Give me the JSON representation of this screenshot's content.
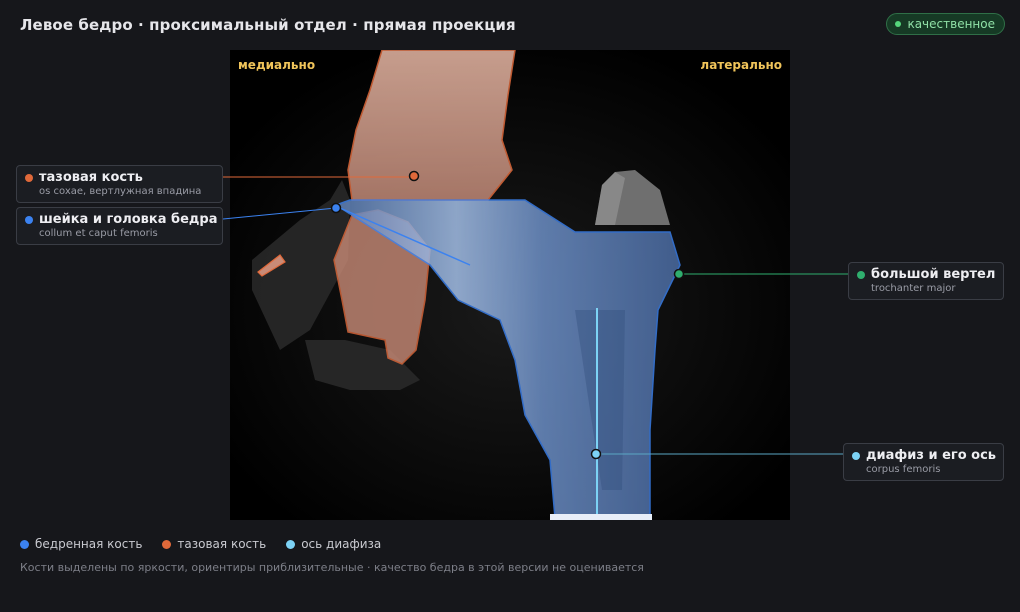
{
  "header": {
    "title": "Левое бедро · проксимальный отдел · прямая проекция",
    "quality_badge": "качественное",
    "quality_color": "#55d67c"
  },
  "viewer": {
    "orientation_left": "медиально",
    "orientation_right": "латерально"
  },
  "callouts": {
    "pelvis": {
      "name": "тазовая кость",
      "latin": "os coxae, вертлужная впадина",
      "color": "#e0693a"
    },
    "neck": {
      "name": "шейка и головка бедра",
      "latin": "collum et caput femoris",
      "color": "#3b82f0"
    },
    "trochanter": {
      "name": "большой вертел",
      "latin": "trochanter major",
      "color": "#2fae6e"
    },
    "shaft": {
      "name": "диафиз и его ось",
      "latin": "corpus femoris",
      "color": "#7cd2f5"
    }
  },
  "legend": {
    "femur": {
      "label": "бедренная кость",
      "color": "#3b82f0"
    },
    "pelvis": {
      "label": "тазовая кость",
      "color": "#e0693a"
    },
    "axis": {
      "label": "ось диафиза",
      "color": "#7cd2f5"
    }
  },
  "footnote": "Кости выделены по яркости, ориентиры приблизительные · качество бедра в этой версии не оценивается"
}
